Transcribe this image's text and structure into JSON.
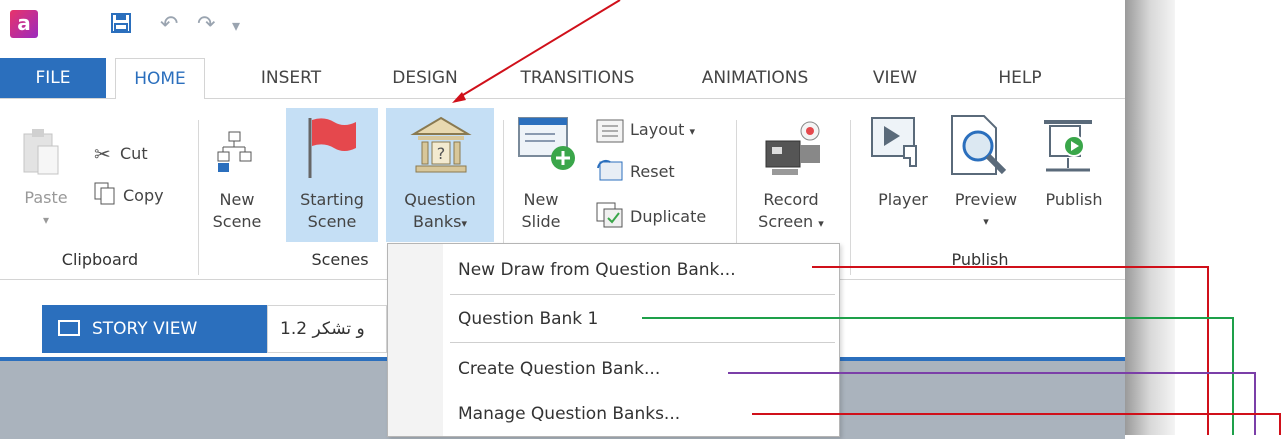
{
  "qat": {
    "app_icon": "a"
  },
  "tabs": [
    {
      "label": "FILE"
    },
    {
      "label": "HOME"
    },
    {
      "label": "INSERT"
    },
    {
      "label": "DESIGN"
    },
    {
      "label": "TRANSITIONS"
    },
    {
      "label": "ANIMATIONS"
    },
    {
      "label": "VIEW"
    },
    {
      "label": "HELP"
    }
  ],
  "ribbon": {
    "clipboard": {
      "paste": "Paste",
      "cut": "Cut",
      "copy": "Copy",
      "group": "Clipboard"
    },
    "scenes": {
      "new_scene_1": "New",
      "new_scene_2": "Scene",
      "starting_scene_1": "Starting",
      "starting_scene_2": "Scene",
      "question_banks_1": "Question",
      "question_banks_2": "Banks",
      "group": "Scenes"
    },
    "slides": {
      "new_slide_1": "New",
      "new_slide_2": "Slide",
      "layout": "Layout",
      "reset": "Reset",
      "duplicate": "Duplicate",
      "record_1": "Record",
      "record_2": "Screen"
    },
    "publish": {
      "player": "Player",
      "preview": "Preview",
      "publish": "Publish",
      "group": "Publish"
    }
  },
  "story": {
    "tab_label": "STORY VIEW",
    "scene_tab": "1.2 و تشكر"
  },
  "menu": {
    "items": [
      {
        "label": "New Draw from Question Bank..."
      },
      {
        "label": "Question Bank 1"
      },
      {
        "label": "Create Question Bank..."
      },
      {
        "label": "Manage Question Banks..."
      }
    ]
  },
  "colors": {
    "accent": "#2b6fbd",
    "selected": "#c5dff5",
    "red": "#d0101a",
    "green": "#1ea04a",
    "purple": "#7b3fa8"
  }
}
